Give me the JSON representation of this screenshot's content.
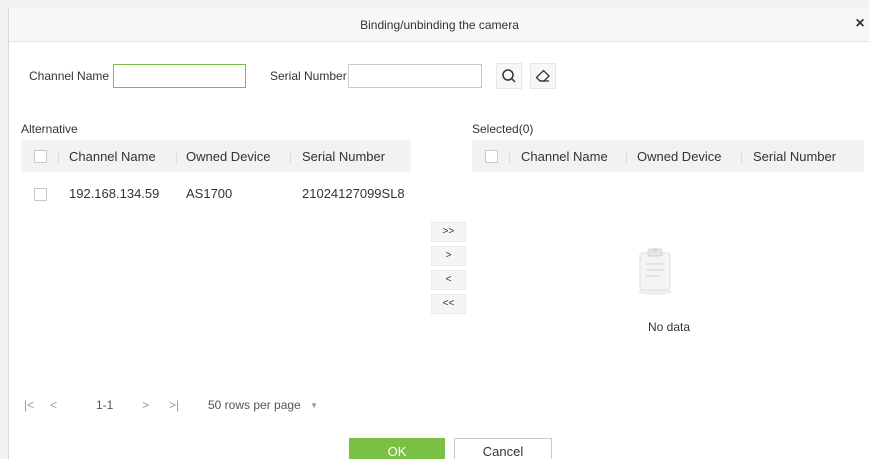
{
  "dialog": {
    "title": "Binding/unbinding the camera",
    "close_glyph": "×"
  },
  "filters": {
    "channel_name_label": "Channel Name",
    "channel_name_value": "",
    "serial_number_label": "Serial Number",
    "serial_number_value": "",
    "search_icon": "search-icon",
    "clear_icon": "eraser-icon"
  },
  "alternative": {
    "title": "Alternative",
    "columns": [
      "Channel Name",
      "Owned Device",
      "Serial Number"
    ],
    "rows": [
      {
        "channel_name": "192.168.134.59",
        "owned_device": "AS1700",
        "serial_number": "21024127099SL8"
      }
    ]
  },
  "selected": {
    "title": "Selected(0)",
    "columns": [
      "Channel Name",
      "Owned Device",
      "Serial Number"
    ],
    "empty_text": "No data",
    "empty_icon": "clipboard-icon"
  },
  "transfer": {
    "add_all": ">>",
    "add": ">",
    "remove": "<",
    "remove_all": "<<"
  },
  "pagination": {
    "first": "|<",
    "prev": "<",
    "range": "1-1",
    "next": ">",
    "last": ">|",
    "rows_per_page": "50 rows per page",
    "dropdown_glyph": "▼"
  },
  "footer": {
    "ok_label": "OK",
    "cancel_label": "Cancel"
  },
  "colors": {
    "accent": "#7ac143",
    "header_bg": "#f2f2f2"
  }
}
